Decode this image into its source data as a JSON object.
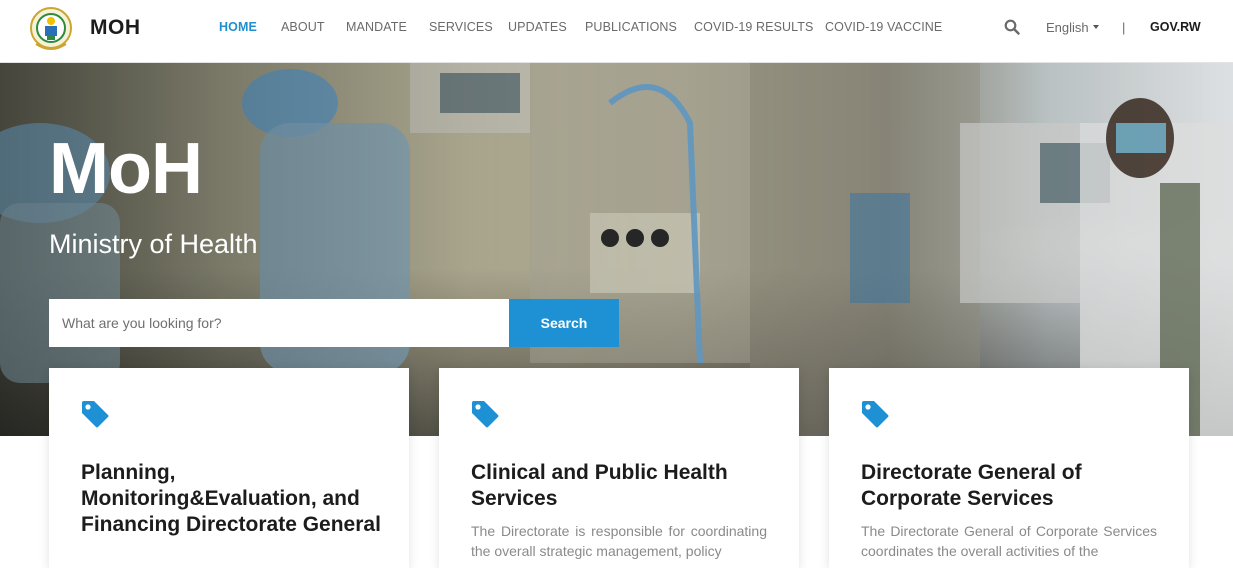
{
  "header": {
    "brand": "MOH",
    "nav": [
      {
        "label": "HOME",
        "active": true
      },
      {
        "label": "ABOUT",
        "active": false
      },
      {
        "label": "MANDATE",
        "active": false
      },
      {
        "label": "SERVICES",
        "active": false
      },
      {
        "label": "UPDATES",
        "active": false
      },
      {
        "label": "PUBLICATIONS",
        "active": false
      },
      {
        "label": "COVID-19 RESULTS",
        "active": false
      },
      {
        "label": "COVID-19 VACCINE",
        "active": false
      }
    ],
    "search_icon": "search-icon",
    "language": "English",
    "divider": "|",
    "gov_link": "GOV.RW"
  },
  "hero": {
    "title": "MoH",
    "subtitle": "Ministry of Health",
    "search_placeholder": "What are you looking for?",
    "search_button": "Search"
  },
  "cards": [
    {
      "icon": "tag-icon",
      "title": "Planning, Monitoring&Evaluation, and Financing Directorate General",
      "description": ""
    },
    {
      "icon": "tag-icon",
      "title": "Clinical and Public Health Services",
      "description": "The Directorate is responsible for coordinating the overall strategic management, policy"
    },
    {
      "icon": "tag-icon",
      "title": "Directorate General of Corporate Services",
      "description": "The Directorate General of Corporate Services coordinates the overall activities of the"
    }
  ],
  "colors": {
    "accent": "#1e90d4",
    "nav_active": "#1f8fd0",
    "text_dark": "#1c1c1c",
    "text_muted": "#8a8a8a"
  }
}
